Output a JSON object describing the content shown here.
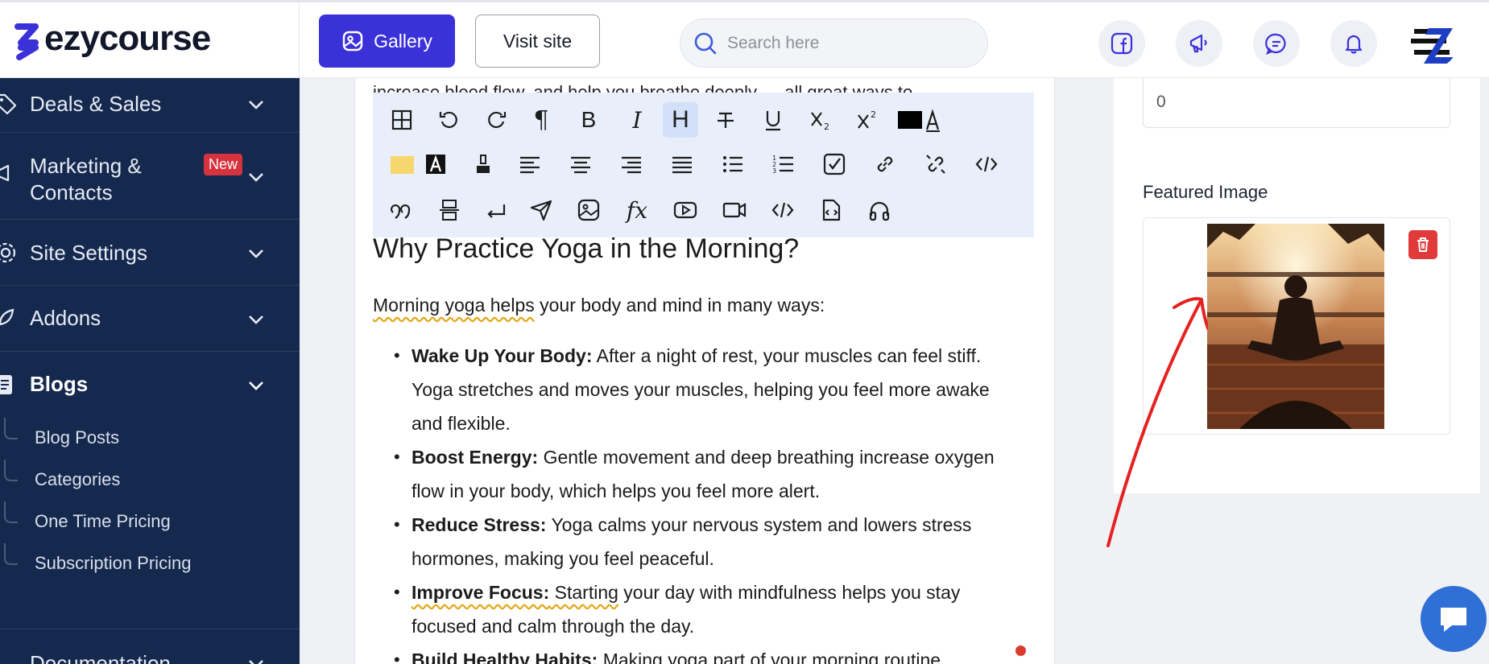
{
  "brand": {
    "name": "ezycourse"
  },
  "header": {
    "gallery_label": "Gallery",
    "visit_label": "Visit site",
    "search_placeholder": "Search here",
    "icons": [
      "facebook-icon",
      "megaphone-icon",
      "chat-icon",
      "bell-icon"
    ]
  },
  "sidebar": {
    "items": [
      {
        "label": "Deals & Sales",
        "icon": "tag-icon"
      },
      {
        "label_line1": "Marketing &",
        "label_line2": "Contacts",
        "badge": "New",
        "icon": "megaphone-icon"
      },
      {
        "label": "Site Settings",
        "icon": "gear-icon"
      },
      {
        "label": "Addons",
        "icon": "rocket-icon"
      },
      {
        "label": "Blogs",
        "icon": "document-icon",
        "expanded": true
      },
      {
        "label": "Documentation",
        "icon": "book-icon"
      }
    ],
    "blog_subitems": [
      "Blog Posts",
      "Categories",
      "One Time Pricing",
      "Subscription Pricing"
    ]
  },
  "editor": {
    "partial_line": "increase blood flow, and help you breathe deeply — all great ways to",
    "heading": "Why Practice Yoga in the Morning?",
    "intro_underlined": "Morning yoga helps",
    "intro_rest": " your body and mind in many ways:",
    "bullets": [
      {
        "title": "Wake Up Your Body:",
        "text": " After a night of rest, your muscles can feel stiff. Yoga stretches and moves your muscles, helping you feel more awake and flexible."
      },
      {
        "title": "Boost Energy:",
        "text": " Gentle movement and deep breathing increase oxygen flow in your body, which helps you feel more alert."
      },
      {
        "title": "Reduce Stress:",
        "text": " Yoga calms your nervous system and lowers stress hormones, making you feel peaceful."
      },
      {
        "title": "Improve Focus:",
        "title_rest": " Starting",
        "text": " your day with mindfulness helps you stay focused and calm through the day."
      },
      {
        "title": "Build Healthy Habits:",
        "text": " Making yoga part of your morning routine"
      }
    ],
    "toolbar_text": {
      "paragraph": "¶",
      "bold": "B",
      "italic": "I",
      "heading": "H",
      "fx": "fx"
    }
  },
  "right_panel": {
    "number_value": "0",
    "featured_image_label": "Featured Image"
  },
  "colors": {
    "primary": "#3b31d9",
    "sidebar_bg": "#15294f",
    "badge_red": "#d6333f",
    "delete_red": "#e03a3a",
    "annotation_red": "#e52222"
  }
}
